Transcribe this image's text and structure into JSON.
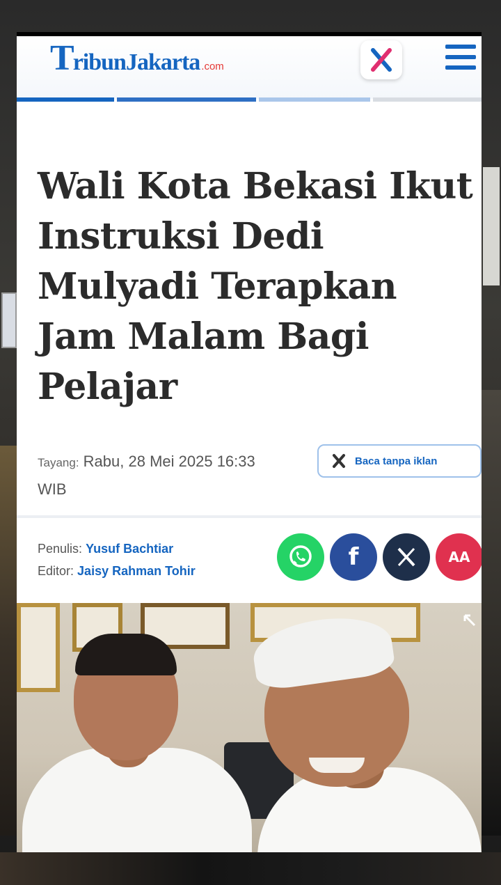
{
  "site": {
    "logo_text": "TribunJakarta",
    "logo_t": "T",
    "logo_rest": "ribunJakarta",
    "logo_suffix": ".com"
  },
  "header": {
    "x_icon": "x-brand-icon",
    "menu_icon": "hamburger-menu-icon"
  },
  "article": {
    "headline": "Wali Kota Bekasi Ikut Instruksi Dedi Mulyadi Terapkan Jam Malam Bagi Pelajar",
    "published_label": "Tayang:",
    "published_value": "Rabu, 28 Mei 2025 16:33",
    "published_tz": "WIB",
    "ad_free_label": "Baca tanpa iklan",
    "writer_label": "Penulis:",
    "writer_name": "Yusuf Bachtiar",
    "editor_label": "Editor:",
    "editor_name": "Jaisy Rahman Tohir"
  },
  "share": {
    "whatsapp_icon": "whatsapp-icon",
    "facebook_icon": "facebook-icon",
    "facebook_glyph": "f",
    "x_icon": "x-icon",
    "x_glyph": "𝕏",
    "font_size_glyph": "AA"
  },
  "colors": {
    "brand_blue": "#1565c0",
    "whatsapp_green": "#25d366",
    "facebook_blue": "#2a4e9c",
    "x_navy": "#1e2f4a",
    "font_red": "#e0314f"
  }
}
